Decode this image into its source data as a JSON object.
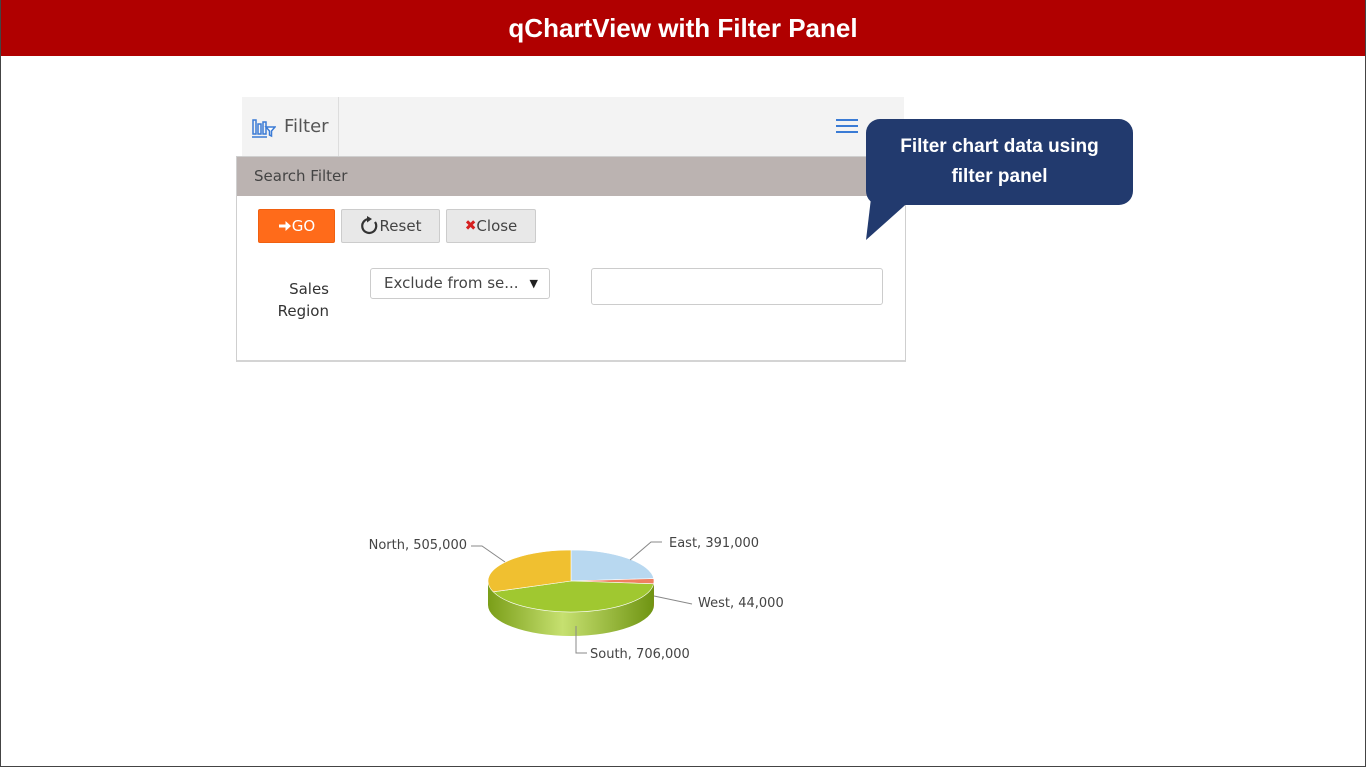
{
  "banner": {
    "title": "qChartView with Filter Panel"
  },
  "toolbar": {
    "filter_label": "Filter",
    "menu_icon": "hamburger-menu-icon"
  },
  "panel": {
    "header": "Search Filter",
    "buttons": {
      "go": "GO",
      "reset": "Reset",
      "close": "Close"
    },
    "field": {
      "label_line1": "Sales",
      "label_line2": "Region",
      "select_value": "Exclude from se...",
      "text_value": ""
    }
  },
  "callout": {
    "line1": "Filter chart data using",
    "line2": "filter panel"
  },
  "colors": {
    "banner": "#b00000",
    "go": "#ff6b1a",
    "callout": "#223a6e"
  },
  "chart_data": {
    "type": "pie",
    "slices": [
      {
        "label": "North",
        "value": 505000,
        "text": "North, 505,000",
        "color": "#f0c030"
      },
      {
        "label": "East",
        "value": 391000,
        "text": "East, 391,000",
        "color": "#b8d8f0"
      },
      {
        "label": "West",
        "value": 44000,
        "text": "West, 44,000",
        "color": "#f08060"
      },
      {
        "label": "South",
        "value": 706000,
        "text": "South, 706,000",
        "color": "#a0c830"
      }
    ]
  }
}
